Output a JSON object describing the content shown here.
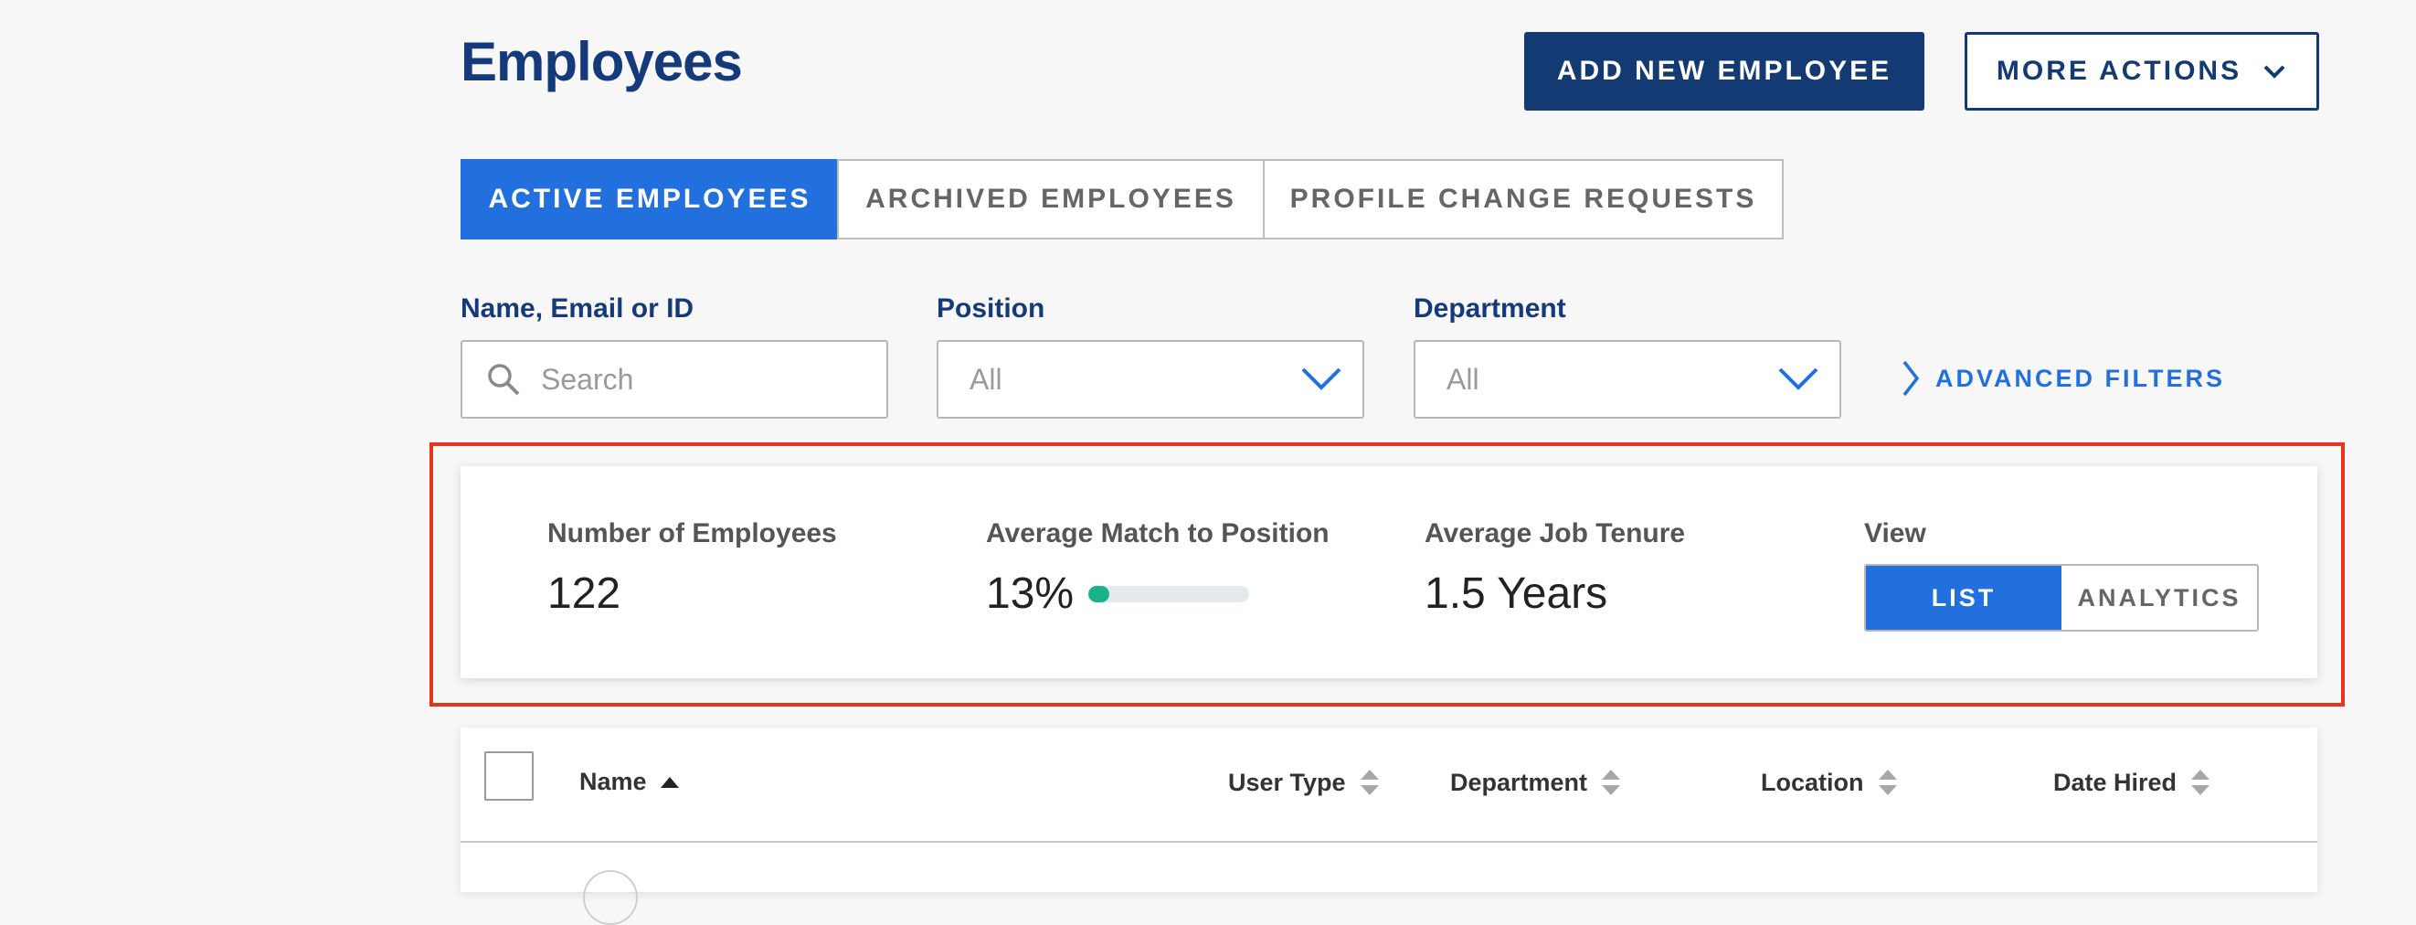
{
  "header": {
    "title": "Employees",
    "add_button": "ADD NEW EMPLOYEE",
    "more_actions": "MORE ACTIONS"
  },
  "tabs": [
    {
      "label": "ACTIVE EMPLOYEES",
      "active": true
    },
    {
      "label": "ARCHIVED EMPLOYEES",
      "active": false
    },
    {
      "label": "PROFILE CHANGE REQUESTS",
      "active": false
    }
  ],
  "filters": {
    "search": {
      "label": "Name, Email or ID",
      "placeholder": "Search",
      "value": ""
    },
    "position": {
      "label": "Position",
      "value": "All"
    },
    "department": {
      "label": "Department",
      "value": "All"
    },
    "advanced": "ADVANCED FILTERS"
  },
  "stats": {
    "employees": {
      "label": "Number of Employees",
      "value": "122"
    },
    "match": {
      "label": "Average Match to Position",
      "value": "13%",
      "progress_fraction": 0.13
    },
    "tenure": {
      "label": "Average Job Tenure",
      "value": "1.5 Years"
    },
    "view": {
      "label": "View",
      "options": [
        "LIST",
        "ANALYTICS"
      ],
      "selected": "LIST"
    }
  },
  "table": {
    "columns": {
      "name": "Name",
      "user_type": "User Type",
      "department": "Department",
      "location": "Location",
      "date_hired": "Date Hired"
    },
    "sorted_by": "Name",
    "sort_direction": "ascending"
  },
  "colors": {
    "brand_navy": "#143a73",
    "accent_blue": "#2270de",
    "progress_green": "#17b38a",
    "highlight_red": "#e8341c"
  }
}
